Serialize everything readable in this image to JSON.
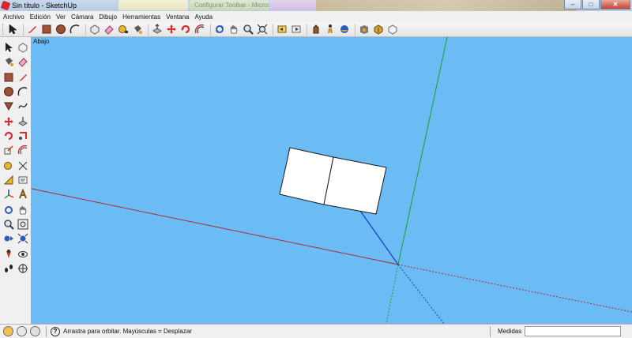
{
  "window": {
    "title": "Sin título - SketchUp",
    "background_tabs": [
      "Configurar Toolbar - Micros",
      "",
      ""
    ],
    "buttons": {
      "minimize": "–",
      "maximize": "□",
      "close": "✕"
    }
  },
  "menu": {
    "items": [
      "Archivo",
      "Edición",
      "Ver",
      "Cámara",
      "Dibujo",
      "Herramientas",
      "Ventana",
      "Ayuda"
    ]
  },
  "toolbar_top": {
    "tools": [
      "select-icon",
      "pencil-icon",
      "rectangle-icon",
      "circle-icon",
      "arc-icon",
      "make-component-icon",
      "eraser-icon",
      "tape-measure-icon",
      "paint-bucket-icon",
      "push-pull-icon",
      "move-icon",
      "rotate-icon",
      "offset-icon",
      "orbit-icon",
      "pan-icon",
      "zoom-icon",
      "zoom-extents-icon",
      "previous-view-icon",
      "next-view-icon",
      "section-plane-icon",
      "walk-icon",
      "position-camera-icon",
      "look-around-icon",
      "get-models-icon",
      "share-model-icon",
      "warehouse-icon"
    ]
  },
  "viewport": {
    "view_name": "Abajo",
    "colors": {
      "background": "#6bbcf5",
      "red_axis": "#b0253a",
      "green_axis": "#18a024",
      "blue_axis": "#1a3ac8",
      "face": "#ffffff",
      "edge": "#1b1b1b"
    }
  },
  "statusbar": {
    "icons": [
      "geolocation-icon",
      "credits-icon",
      "user-icon"
    ],
    "help_glyph": "?",
    "message": "Arrastra para orbitar. Mayúsculas = Desplazar",
    "measurements_label": "Medidas",
    "measurements_value": ""
  }
}
